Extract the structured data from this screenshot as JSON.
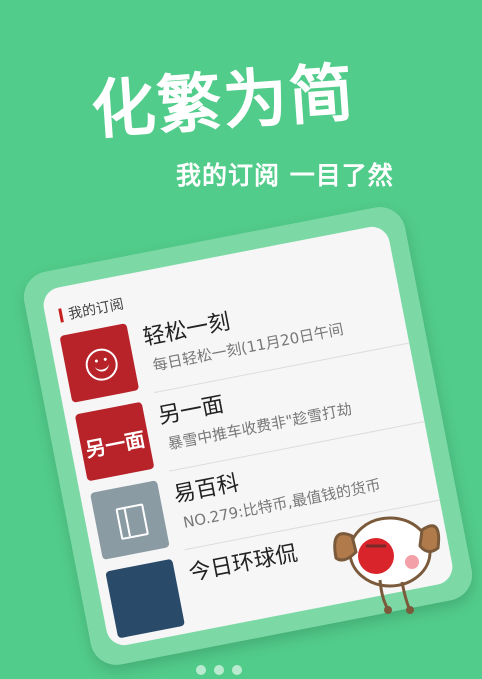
{
  "hero": {
    "title": "化繁为简",
    "subtitle": "我的订阅 一目了然"
  },
  "subscriptions": {
    "section_title": "我的订阅",
    "items": [
      {
        "name": "轻松一刻",
        "desc": "每日轻松一刻(11月20日午间",
        "icon": "smiley-icon",
        "thumb_color": "#b8232a"
      },
      {
        "name": "另一面",
        "desc": "暴雪中推车收费非\"趁雪打劫",
        "icon": "另一面-logo",
        "logo_text": "另一面",
        "thumb_color": "#b8232a"
      },
      {
        "name": "易百科",
        "desc": "NO.279:比特币,最值钱的货币",
        "icon": "book-icon",
        "thumb_color": "#8a9ba3"
      },
      {
        "name": "今日环球侃",
        "desc": "",
        "icon": "",
        "thumb_color": "#2a4a6a"
      }
    ]
  },
  "pager": {
    "pages": 3,
    "current": 1
  }
}
